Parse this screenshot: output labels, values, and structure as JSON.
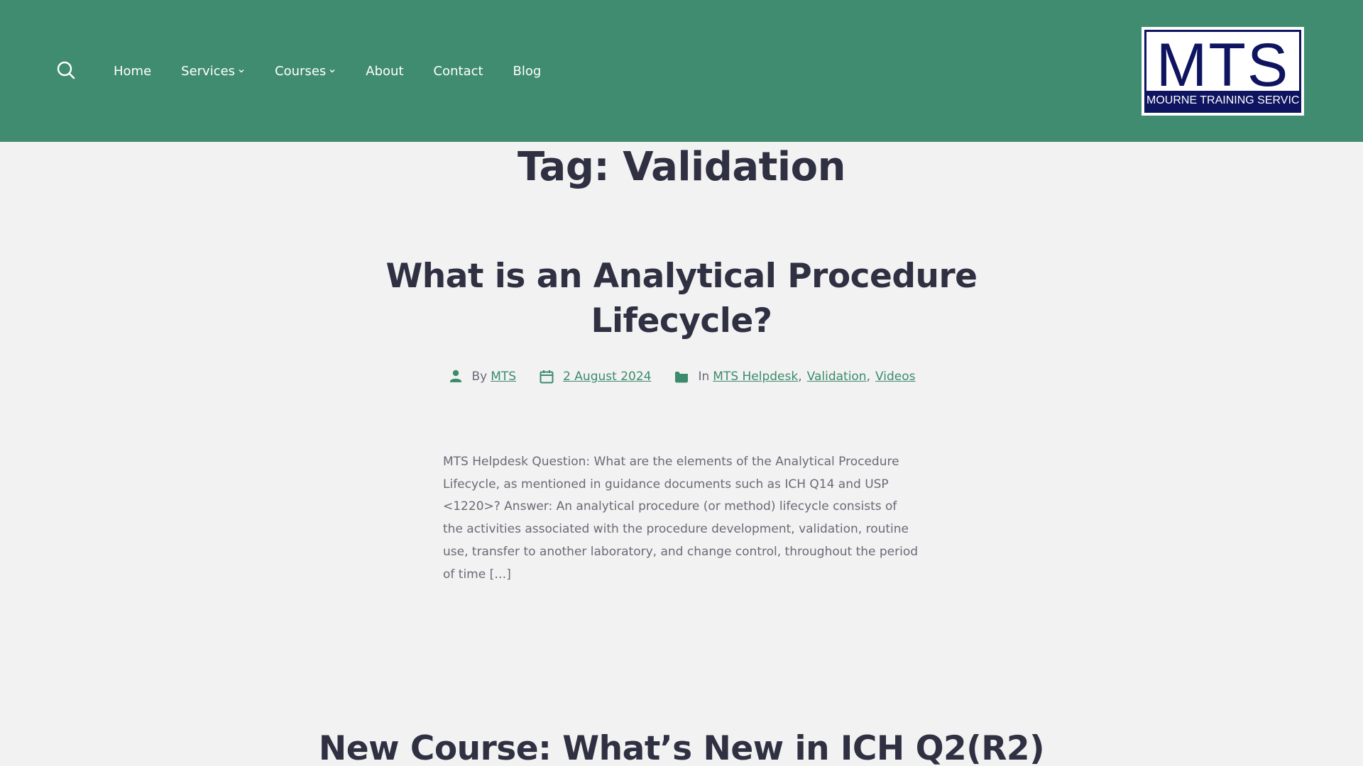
{
  "header": {
    "search_icon": "search-icon",
    "nav": [
      {
        "label": "Home",
        "has_dropdown": false
      },
      {
        "label": "Services",
        "has_dropdown": true
      },
      {
        "label": "Courses",
        "has_dropdown": true
      },
      {
        "label": "About",
        "has_dropdown": false
      },
      {
        "label": "Contact",
        "has_dropdown": false
      },
      {
        "label": "Blog",
        "has_dropdown": false
      }
    ],
    "logo": {
      "mark": "MTS",
      "tagline": "MOURNE TRAINING SERVICES"
    }
  },
  "archive": {
    "title": "Tag: Validation"
  },
  "post": {
    "title": "What is an Analytical Procedure Lifecycle?",
    "meta": {
      "author_prefix": "By",
      "author": "MTS",
      "date": "2 August 2024",
      "categories_prefix": "In",
      "categories": [
        "MTS Helpdesk",
        "Validation",
        "Videos"
      ],
      "separator": ","
    },
    "excerpt": "MTS Helpdesk Question: What are the elements of the Analytical Procedure Lifecycle, as mentioned in guidance documents such as ICH Q14 and USP <1220>? Answer: An analytical procedure (or method) lifecycle consists of the activities associated with the procedure development, validation, routine use, transfer to another laboratory, and change control, throughout the period of time […]"
  },
  "next_post": {
    "title": "New Course: What’s New in ICH Q2(R2)"
  },
  "colors": {
    "header_bg": "#408c70",
    "page_bg": "#f2f2f2",
    "heading": "#2f3042",
    "accent": "#3d8b6d",
    "logo_navy": "#0e1460"
  }
}
